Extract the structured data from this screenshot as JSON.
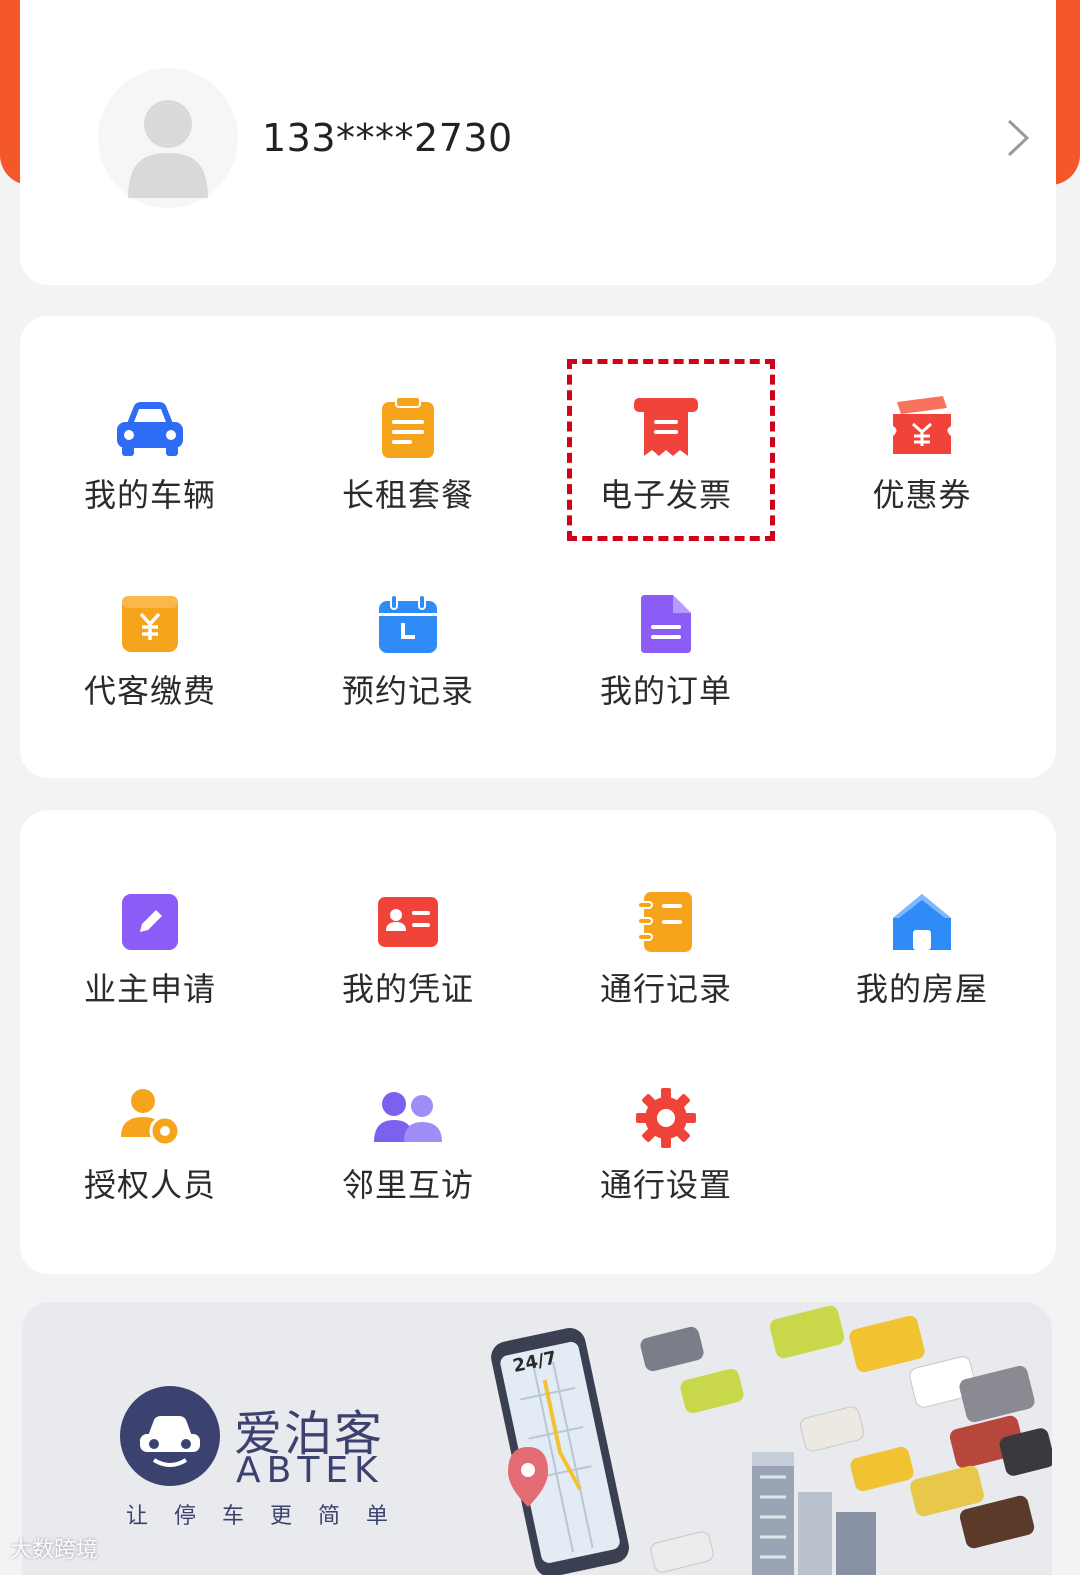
{
  "profile": {
    "phone": "133****2730"
  },
  "services_primary": [
    {
      "label": "我的车辆",
      "icon": "car-icon",
      "color": "#2f6cf6"
    },
    {
      "label": "长租套餐",
      "icon": "clipboard-icon",
      "color": "#f7a41d"
    },
    {
      "label": "电子发票",
      "icon": "invoice-icon",
      "color": "#f0433a",
      "highlighted": true
    },
    {
      "label": "优惠券",
      "icon": "coupon-icon",
      "color": "#f0433a"
    },
    {
      "label": "代客缴费",
      "icon": "payment-icon",
      "color": "#f7a41d"
    },
    {
      "label": "预约记录",
      "icon": "calendar-icon",
      "color": "#2f8cf6"
    },
    {
      "label": "我的订单",
      "icon": "document-icon",
      "color": "#8b5cf6"
    }
  ],
  "services_secondary": [
    {
      "label": "业主申请",
      "icon": "edit-icon",
      "color": "#8b5cf6"
    },
    {
      "label": "我的凭证",
      "icon": "id-card-icon",
      "color": "#f0433a"
    },
    {
      "label": "通行记录",
      "icon": "record-list-icon",
      "color": "#f7a41d"
    },
    {
      "label": "我的房屋",
      "icon": "house-icon",
      "color": "#2f8cf6"
    },
    {
      "label": "授权人员",
      "icon": "authorized-person-icon",
      "color": "#f7a41d"
    },
    {
      "label": "邻里互访",
      "icon": "neighbors-icon",
      "color": "#7b61ee"
    },
    {
      "label": "通行设置",
      "icon": "gear-icon",
      "color": "#f0433a"
    }
  ],
  "banner": {
    "brand_cn": "爱泊客",
    "brand_en": "ABTEK",
    "slogan": "让停车更简单",
    "clock_text": "24/7"
  },
  "watermark": "大数跨境"
}
